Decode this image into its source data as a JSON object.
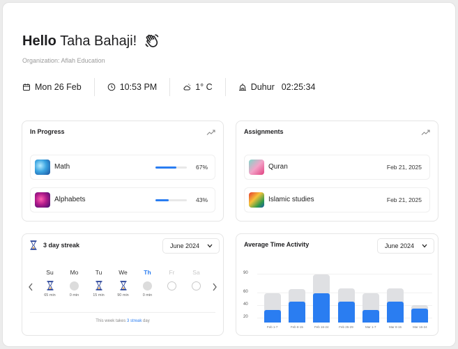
{
  "greeting": {
    "hello": "Hello",
    "name": "Taha Bahaji!"
  },
  "organization": "Organization: Aflah Education",
  "infobar": {
    "date": "Mon 26 Feb",
    "time": "10:53 PM",
    "temperature": "1° C",
    "prayer_name": "Duhur",
    "prayer_countdown": "02:25:34"
  },
  "in_progress": {
    "title": "In Progress",
    "items": [
      {
        "label": "Math",
        "percent": 67,
        "percent_label": "67%"
      },
      {
        "label": "Alphabets",
        "percent": 43,
        "percent_label": "43%"
      }
    ]
  },
  "assignments": {
    "title": "Assignments",
    "items": [
      {
        "label": "Quran",
        "date": "Feb 21, 2025"
      },
      {
        "label": "Islamic studies",
        "date": "Feb 21, 2025"
      }
    ]
  },
  "streak": {
    "title": "3 day streak",
    "month": "June 2024",
    "days": [
      {
        "name": "Su",
        "state": "done",
        "minutes": "65 min"
      },
      {
        "name": "Mo",
        "state": "missed",
        "minutes": "0 min"
      },
      {
        "name": "Tu",
        "state": "done",
        "minutes": "15 min"
      },
      {
        "name": "We",
        "state": "done",
        "minutes": "90 min"
      },
      {
        "name": "Th",
        "state": "today",
        "minutes": "0 min"
      },
      {
        "name": "Fr",
        "state": "future",
        "minutes": ""
      },
      {
        "name": "Sa",
        "state": "future",
        "minutes": ""
      }
    ],
    "footer_prefix": "This week takes",
    "footer_highlight": "3 streak",
    "footer_suffix": "day"
  },
  "activity": {
    "title": "Average Time Activity",
    "month": "June 2024"
  },
  "colors": {
    "accent": "#2a7df1",
    "bar_bg": "#dfe0e3"
  },
  "chart_data": {
    "type": "bar",
    "categories": [
      "Feb 1-7",
      "Feb 8-15",
      "Feb 16-24",
      "Feb 25-29",
      "Mar 1-7",
      "Mar 8-15",
      "Mar 16-24"
    ],
    "series": [
      {
        "values": [
          58,
          65,
          88,
          66,
          58,
          66,
          40
        ]
      },
      {
        "values": [
          32,
          45,
          58,
          45,
          32,
          45,
          34
        ]
      }
    ],
    "yticks": [
      90,
      60,
      40,
      20
    ],
    "ylim": [
      12,
      95
    ]
  }
}
